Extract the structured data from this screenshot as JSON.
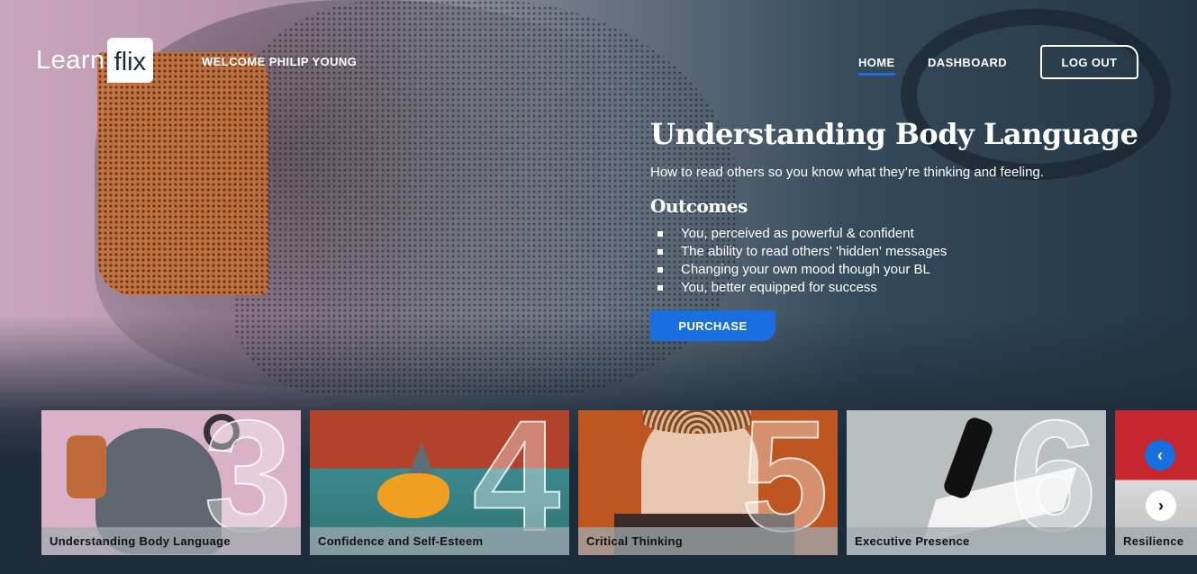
{
  "header": {
    "logo_left": "Learn",
    "logo_right": "flix",
    "welcome": "WELCOME PHILIP YOUNG",
    "nav": {
      "home": "HOME",
      "dashboard": "DASHBOARD"
    },
    "logout": "LOG OUT"
  },
  "course": {
    "title": "Understanding Body Language",
    "subtitle": "How to read others so you know what they’re thinking and feeling.",
    "outcomes_heading": "Outcomes",
    "outcomes": [
      "You, perceived as powerful & confident",
      "The ability to read others' 'hidden' messages",
      "Changing your own mood though your BL",
      "You, better equipped for success"
    ],
    "purchase": "PURCHASE"
  },
  "carousel": {
    "cards": [
      {
        "number": "3",
        "label": "Understanding Body Language"
      },
      {
        "number": "4",
        "label": "Confidence and Self-Esteem"
      },
      {
        "number": "5",
        "label": "Critical Thinking"
      },
      {
        "number": "6",
        "label": "Executive Presence"
      },
      {
        "number": "",
        "label": "Resilience"
      }
    ],
    "prev_icon": "chevron-left-icon",
    "next_icon": "chevron-right-icon"
  },
  "colors": {
    "accent": "#1a6fe0",
    "background": "#1d2c3a"
  }
}
